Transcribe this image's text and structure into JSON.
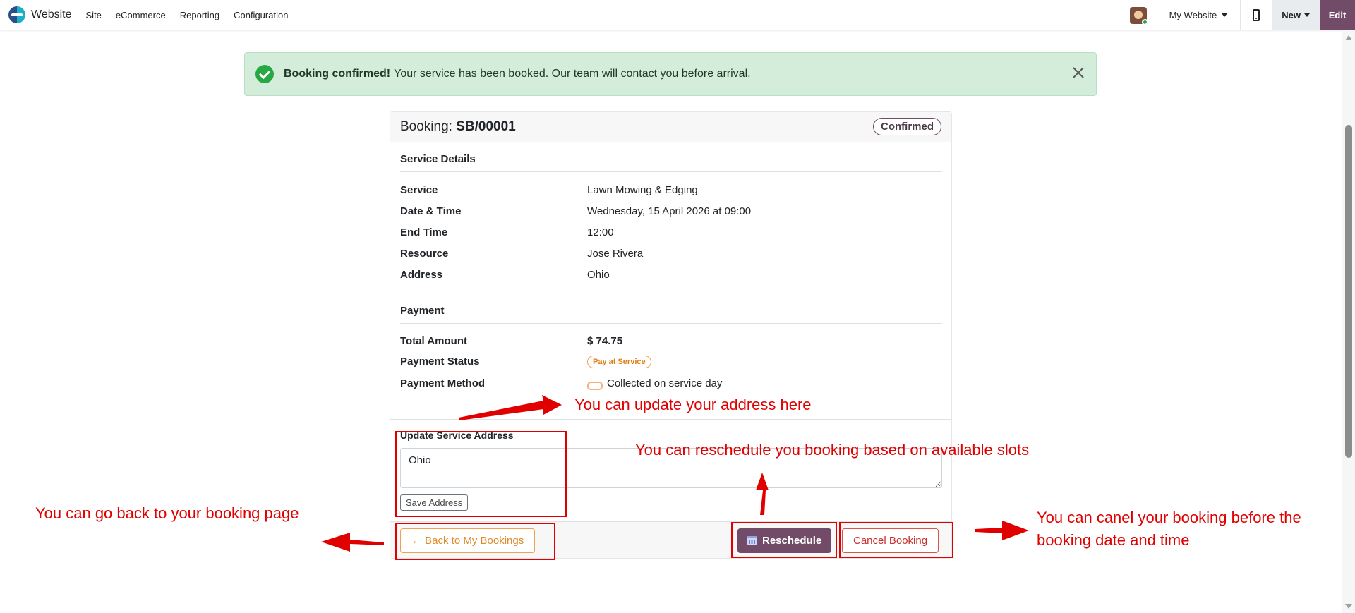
{
  "navbar": {
    "brand": "Website",
    "menu": [
      "Site",
      "eCommerce",
      "Reporting",
      "Configuration"
    ],
    "website_selector": "My Website",
    "new_label": "New",
    "edit_label": "Edit"
  },
  "alert": {
    "title": "Booking confirmed!",
    "message": "Your service has been booked. Our team will contact you before arrival."
  },
  "booking": {
    "title_prefix": "Booking:",
    "reference": "SB/00001",
    "status": "Confirmed",
    "service_section": "Service Details",
    "service_rows": [
      {
        "label": "Service",
        "value": "Lawn Mowing & Edging"
      },
      {
        "label": "Date & Time",
        "value": "Wednesday, 15 April 2026 at 09:00"
      },
      {
        "label": "End Time",
        "value": "12:00"
      },
      {
        "label": "Resource",
        "value": "Jose Rivera"
      },
      {
        "label": "Address",
        "value": "Ohio"
      }
    ],
    "payment_section": "Payment",
    "payment": {
      "total_label": "Total Amount",
      "total_value": "$ 74.75",
      "status_label": "Payment Status",
      "status_value": "Pay at Service",
      "method_label": "Payment Method",
      "method_value": "Collected on service day"
    },
    "update_address": {
      "label": "Update Service Address",
      "value": "Ohio",
      "save_label": "Save Address"
    },
    "footer": {
      "back_label": "← Back to My Bookings",
      "reschedule_label": "Reschedule",
      "cancel_label": "Cancel Booking"
    }
  },
  "annotations": {
    "address": "You can update your address here",
    "reschedule": "You can reschedule you booking based on available slots",
    "back": "You can go back to your booking page",
    "cancel": "You can canel your booking before the booking date and time",
    "color": "#e00000"
  },
  "colors": {
    "primary": "#714b67",
    "alert_bg": "#d4edda",
    "success": "#28a745",
    "warning": "#f0a050",
    "danger": "#d9534f"
  }
}
